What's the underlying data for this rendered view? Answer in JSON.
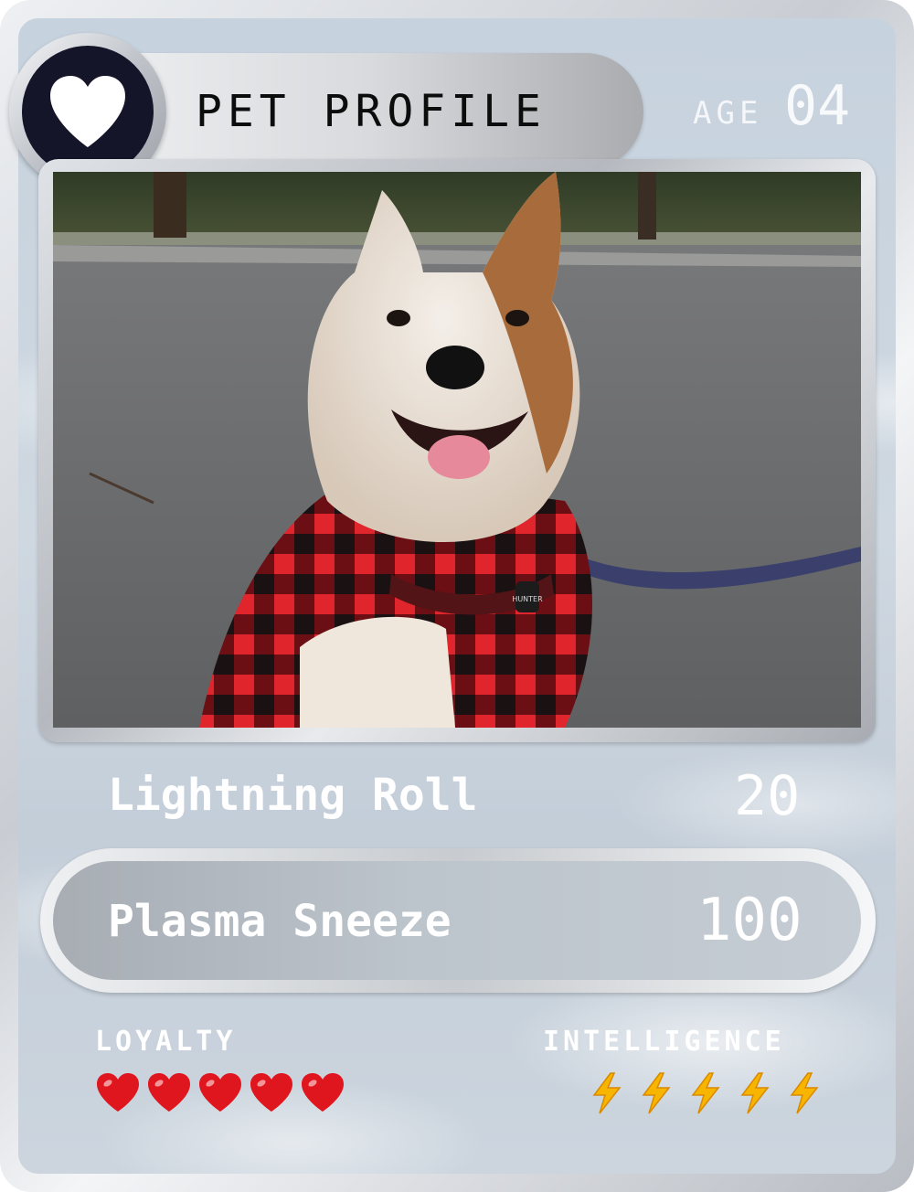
{
  "header": {
    "title": "PET PROFILE",
    "age_label": "AGE",
    "age_value": "04",
    "badge_icon": "heart-icon"
  },
  "photo": {
    "subject": "dog-photo",
    "tag_text": "HUNTER"
  },
  "moves": [
    {
      "name": "Lightning Roll",
      "value": "20"
    },
    {
      "name": "Plasma Sneeze",
      "value": "100"
    }
  ],
  "stats": {
    "loyalty": {
      "label": "LOYALTY",
      "rating": 5,
      "max": 5,
      "icon": "red-heart-icon",
      "color": "#e0161e"
    },
    "intelligence": {
      "label": "INTELLIGENCE",
      "rating": 5,
      "max": 5,
      "icon": "lightning-bolt-icon",
      "color": "#f7b500"
    }
  }
}
